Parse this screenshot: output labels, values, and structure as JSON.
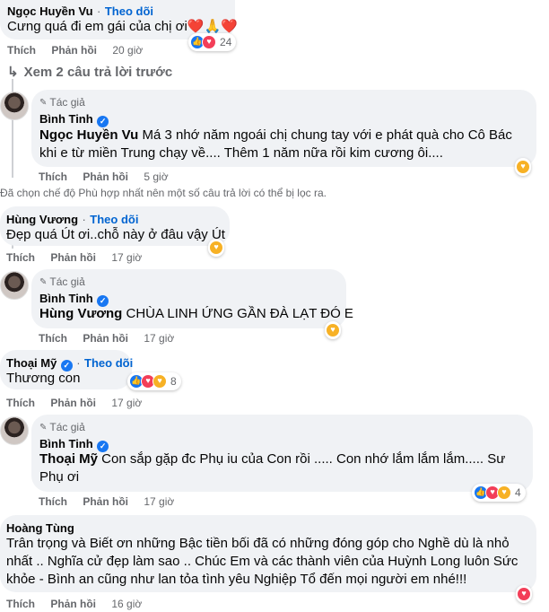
{
  "follow_label": "Theo dõi",
  "like_label": "Thích",
  "reply_label": "Phản hồi",
  "author_tag": "Tác giả",
  "see_more_replies": "Xem 2 câu trả lời trước",
  "filter_notice": "Đã chọn chế độ Phù hợp nhất nên một số câu trả lời có thể bị lọc ra.",
  "comments": [
    {
      "name": "Ngọc Huyền Vu",
      "text": "Cưng quá đi em gái của chị ơi❤️🙏❤️",
      "time": "20 giờ",
      "reactions": "24"
    },
    {
      "name": "Bình Tinh",
      "mention": "Ngọc Huyền Vu",
      "text": " Má 3 nhớ năm ngoái chị chung tay với e phát quà cho Cô Bác khi e từ miền Trung chạy về.... Thêm 1 năm nữa rồi kim cương ôi....",
      "time": "5 giờ"
    },
    {
      "name": "Hùng Vương",
      "text": "Đẹp quá Út ơi..chỗ này ở đâu vậy Út",
      "time": "17 giờ"
    },
    {
      "name": "Bình Tinh",
      "mention": "Hùng Vương",
      "text": " CHÙA LINH ỨNG GẦN ĐÀ LẠT ĐÓ E",
      "time": "17 giờ"
    },
    {
      "name": "Thoại Mỹ",
      "text": "Thương con",
      "time": "17 giờ",
      "reactions": "8"
    },
    {
      "name": "Bình Tinh",
      "mention": "Thoại Mỹ",
      "text": " Con sắp gặp đc Phụ iu của Con rồi ..... Con nhớ lắm lắm lắm..... Sư Phụ ơi",
      "time": "17 giờ",
      "reactions": "4"
    },
    {
      "name": "Hoàng Tùng",
      "text": "Trân trọng và Biết ơn những Bậc tiền bối đã có những đóng góp cho Nghề dù là nhỏ nhất .. Nghĩa cử đẹp làm sao .. Chúc Em và các thành viên của Huỳnh Long luôn Sức khỏe - Bình an cũng như lan tỏa tình yêu Nghiệp Tổ đến mọi người em nhé!!!",
      "time": "16 giờ"
    }
  ]
}
